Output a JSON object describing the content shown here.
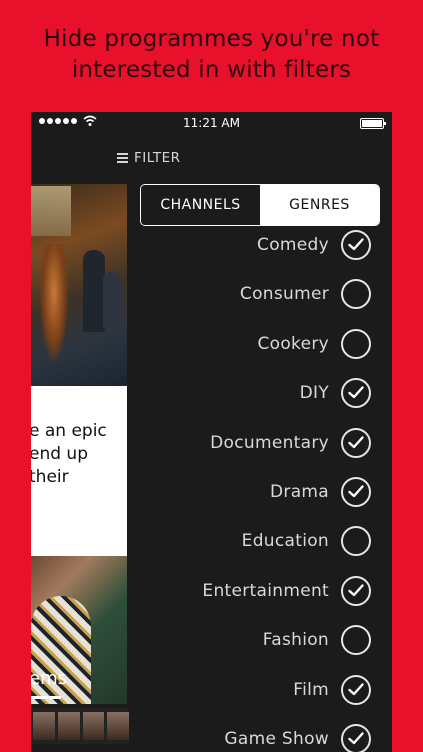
{
  "headline": {
    "line1": "Hide programmes you're not",
    "line2": "interested in with filters"
  },
  "status_bar": {
    "time": "11:21 AM"
  },
  "filter_bar": {
    "label": "FILTER",
    "icon": "menu-icon"
  },
  "left_panel": {
    "text_lines": [
      "e an epic",
      "end up",
      "their"
    ],
    "photo_title": "ems"
  },
  "tabs": [
    {
      "label": "CHANNELS",
      "selected": false
    },
    {
      "label": "GENRES",
      "selected": true
    }
  ],
  "genres": [
    {
      "label": "Comedy",
      "checked": true
    },
    {
      "label": "Consumer",
      "checked": false
    },
    {
      "label": "Cookery",
      "checked": false
    },
    {
      "label": "DIY",
      "checked": true
    },
    {
      "label": "Documentary",
      "checked": true
    },
    {
      "label": "Drama",
      "checked": true
    },
    {
      "label": "Education",
      "checked": false
    },
    {
      "label": "Entertainment",
      "checked": true
    },
    {
      "label": "Fashion",
      "checked": false
    },
    {
      "label": "Film",
      "checked": true
    },
    {
      "label": "Game Show",
      "checked": true
    }
  ],
  "colors": {
    "background": "#e8102a",
    "panel": "#1b1b1b",
    "text_light": "#d9d9d9"
  }
}
